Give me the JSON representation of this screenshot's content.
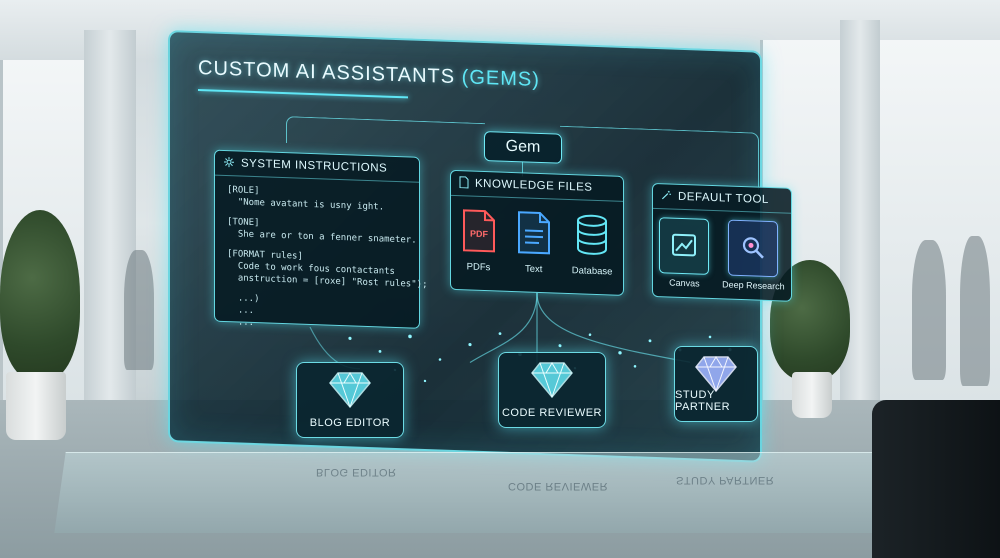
{
  "screen": {
    "title_main": "CUSTOM AI ASSISTANTS",
    "title_highlight": "(GEMS)"
  },
  "root_node": {
    "label": "Gem"
  },
  "system_instructions": {
    "title": "SYSTEM INSTRUCTIONS",
    "lines": [
      "[ROLE]",
      "  \"Nome avatant is usny ight.",
      "",
      "[TONE]",
      "  She are or ton a fenner snameter.",
      "",
      "[FORMAT rules]",
      "  Code to work fous contactants",
      "  anstruction = [roxe] \"Rost rules\");",
      "",
      "  ...)",
      "  ...",
      "  ..."
    ]
  },
  "knowledge_files": {
    "title": "KNOWLEDGE FILES",
    "items": [
      {
        "label": "PDFs",
        "icon": "pdf-file-icon",
        "badge": "PDF"
      },
      {
        "label": "Text",
        "icon": "text-file-icon"
      },
      {
        "label": "Database",
        "icon": "database-icon"
      }
    ]
  },
  "default_tool": {
    "title": "DEFAULT TOOL",
    "items": [
      {
        "label": "Canvas",
        "icon": "canvas-icon"
      },
      {
        "label": "Deep Research",
        "icon": "deep-research-icon"
      }
    ]
  },
  "gems": [
    {
      "label": "BLOG EDITOR",
      "icon": "diamond-icon"
    },
    {
      "label": "CODE REVIEWER",
      "icon": "diamond-icon"
    },
    {
      "label": "STUDY PARTNER",
      "icon": "diamond-icon"
    }
  ],
  "desk_reflection": {
    "left": "BLOG EDITOR",
    "middle": "CODE REVIEWER",
    "right": "STUDY PARTNER"
  },
  "colors": {
    "accent": "#5fe6f5",
    "pdf_red": "#ff5a5a",
    "text_blue": "#4aa8ff",
    "gem_cyan": "#63e6f5",
    "gem_violet": "#9fb4ff"
  }
}
